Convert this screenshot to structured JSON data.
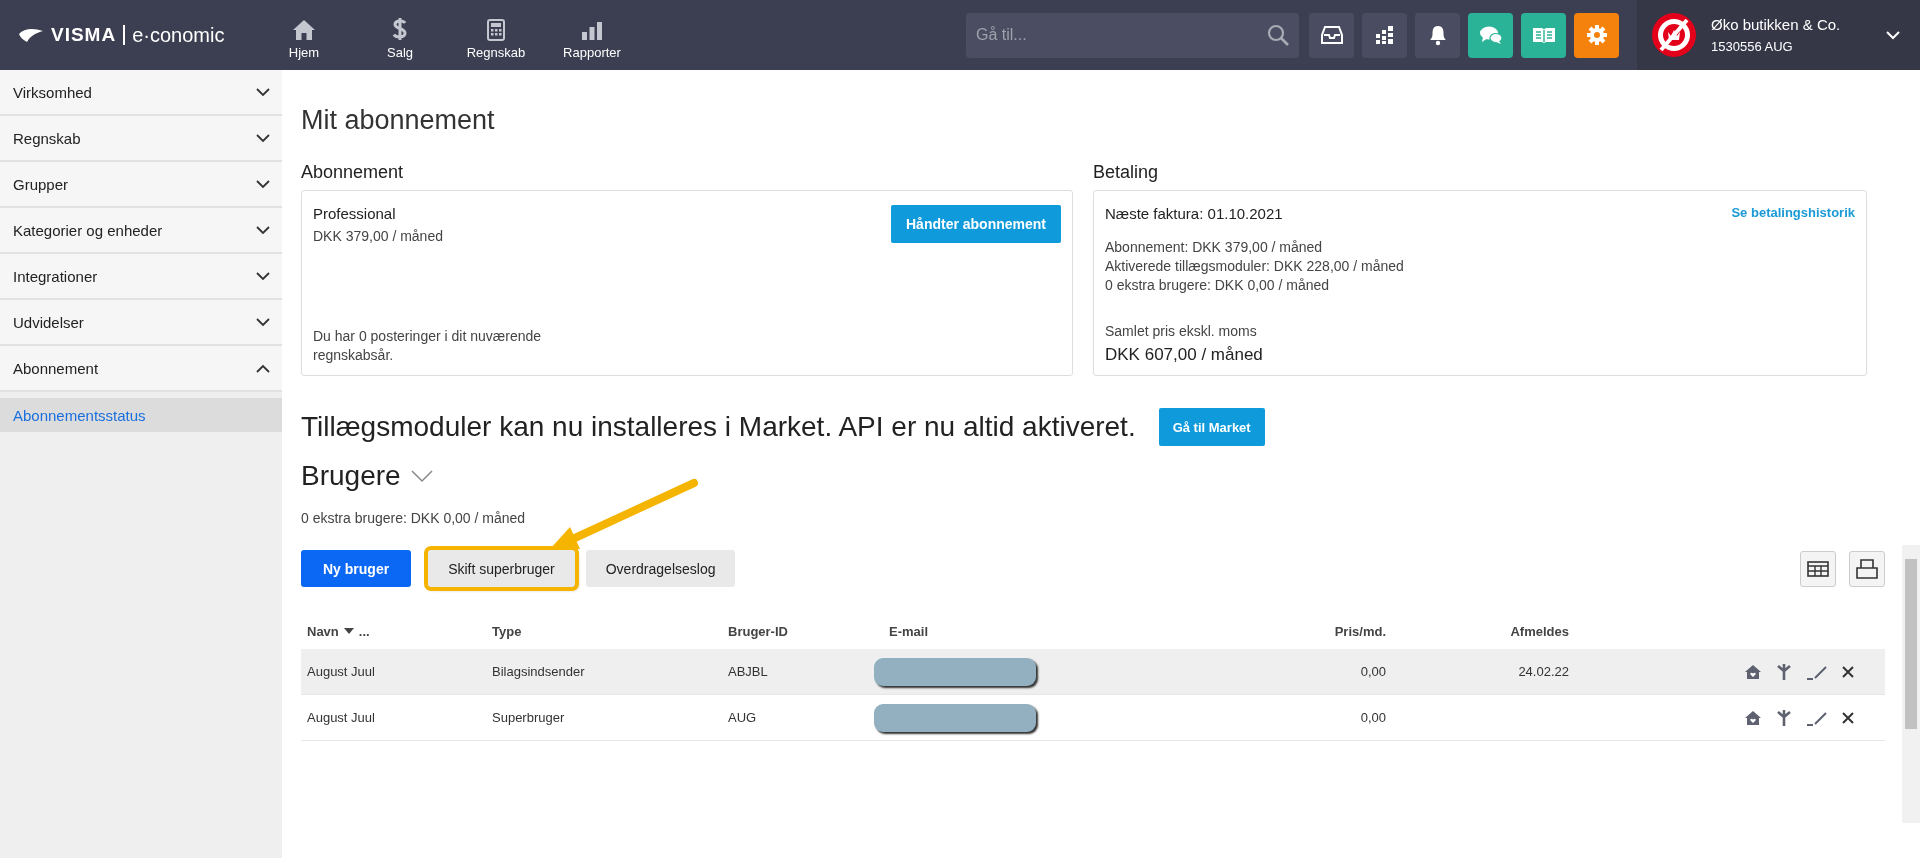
{
  "topbar": {
    "logo_brand": "VISMA",
    "logo_product": "e·conomic",
    "nav": [
      {
        "label": "Hjem"
      },
      {
        "label": "Salg"
      },
      {
        "label": "Regnskab"
      },
      {
        "label": "Rapporter"
      }
    ],
    "search": {
      "placeholder": "Gå til..."
    },
    "tools": [
      {
        "color": "#4a4d61"
      },
      {
        "color": "#4a4d61"
      },
      {
        "color": "#4a4d61"
      },
      {
        "color": "#2bb397"
      },
      {
        "color": "#2bb397"
      },
      {
        "color": "#f5820d"
      }
    ],
    "company": {
      "name": "Øko butikken & Co.",
      "account": "1530556 AUG"
    }
  },
  "sidebar": {
    "items": [
      {
        "label": "Virksomhed",
        "expanded": false
      },
      {
        "label": "Regnskab",
        "expanded": false
      },
      {
        "label": "Grupper",
        "expanded": false
      },
      {
        "label": "Kategorier og enheder",
        "expanded": false
      },
      {
        "label": "Integrationer",
        "expanded": false
      },
      {
        "label": "Udvidelser",
        "expanded": false
      },
      {
        "label": "Abonnement",
        "expanded": true,
        "children": [
          {
            "label": "Abonnementsstatus",
            "selected": true
          }
        ]
      }
    ]
  },
  "page": {
    "title": "Mit abonnement",
    "subscription": {
      "heading": "Abonnement",
      "plan": "Professional",
      "price": "DKK 379,00 / måned",
      "button": "Håndter abonnement",
      "note": "Du har 0 posteringer i dit nuværende regnskabsår."
    },
    "payment": {
      "heading": "Betaling",
      "next_invoice": "Næste faktura: 01.10.2021",
      "history_link": "Se betalingshistorik",
      "lines": [
        "Abonnement: DKK 379,00 / måned",
        "Aktiverede tillægsmoduler: DKK 228,00 / måned",
        "0 ekstra brugere: DKK 0,00 / måned"
      ],
      "total_label": "Samlet pris ekskl. moms",
      "total": "DKK 607,00 / måned"
    },
    "market_notice": "Tillægsmoduler kan nu installeres i Market. API er nu altid aktiveret.",
    "market_button": "Gå til Market",
    "users": {
      "heading": "Brugere",
      "summary": "0 ekstra brugere: DKK 0,00 / måned",
      "buttons": [
        {
          "label": "Ny bruger",
          "kind": "primary",
          "highlighted": false
        },
        {
          "label": "Skift superbruger",
          "kind": "secondary",
          "highlighted": true
        },
        {
          "label": "Overdragelseslog",
          "kind": "secondary",
          "highlighted": false
        }
      ],
      "table": {
        "columns": [
          {
            "label": "Navn",
            "more": "..."
          },
          {
            "label": "Type"
          },
          {
            "label": "Bruger-ID"
          },
          {
            "label": "E-mail"
          },
          {
            "label": "Pris/md."
          },
          {
            "label": "Afmeldes"
          }
        ],
        "rows": [
          {
            "name": "August Juul",
            "type": "Bilagsindsender",
            "user_id": "ABJBL",
            "email_redacted": true,
            "price": "0,00",
            "unsubscribes": "24.02.22",
            "selected": true
          },
          {
            "name": "August Juul",
            "type": "Superbruger",
            "user_id": "AUG",
            "email_redacted": true,
            "price": "0,00",
            "selected": false
          }
        ]
      }
    }
  }
}
